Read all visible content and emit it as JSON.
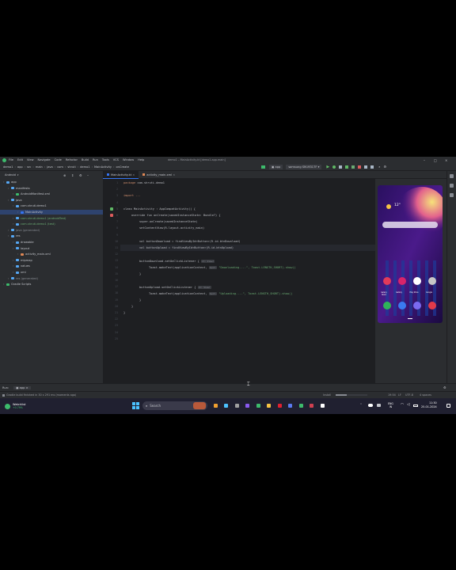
{
  "window": {
    "app_name": "demo1",
    "menus": [
      "File",
      "Edit",
      "View",
      "Navigate",
      "Code",
      "Refactor",
      "Build",
      "Run",
      "Tools",
      "VCS",
      "Window",
      "Help"
    ],
    "title": "demo1 – MainActivity.kt [demo1.app.main]"
  },
  "navbar": {
    "breadcrumbs": [
      "demo1",
      "app",
      "src",
      "main",
      "java",
      "com",
      "shruti",
      "demo1",
      "MainActivity",
      "onCreate"
    ],
    "run_config": "app",
    "device": "samsung SM-M317F"
  },
  "project_panel": {
    "title": "Android",
    "tree": [
      {
        "label": "app",
        "level": 0,
        "color": "#c4c6cc",
        "icon": "#56a8f5"
      },
      {
        "label": "manifests",
        "level": 1,
        "color": "#c4c6cc",
        "icon": "#56a8f5"
      },
      {
        "label": "AndroidManifest.xml",
        "level": 2,
        "color": "#c4c6cc",
        "icon": "#3dbb6c"
      },
      {
        "label": "java",
        "level": 1,
        "color": "#c4c6cc",
        "icon": "#56a8f5"
      },
      {
        "label": "com.shruti.demo1",
        "level": 2,
        "color": "#c4c6cc",
        "icon": "#56a8f5"
      },
      {
        "label": "MainActivity",
        "level": 3,
        "color": "#c4c6cc",
        "icon": "#3574f0"
      },
      {
        "label": "com.shruti.demo1 (androidTest)",
        "level": 2,
        "color": "#6aab73",
        "icon": "#56a8f5"
      },
      {
        "label": "com.shruti.demo1 (test)",
        "level": 2,
        "color": "#6aab73",
        "icon": "#56a8f5"
      },
      {
        "label": "java (generated)",
        "level": 1,
        "color": "#868a91",
        "icon": "#56a8f5"
      },
      {
        "label": "res",
        "level": 1,
        "color": "#c4c6cc",
        "icon": "#56a8f5"
      },
      {
        "label": "drawable",
        "level": 2,
        "color": "#c4c6cc",
        "icon": "#56a8f5"
      },
      {
        "label": "layout",
        "level": 2,
        "color": "#c4c6cc",
        "icon": "#56a8f5"
      },
      {
        "label": "activity_main.xml",
        "level": 3,
        "color": "#c4c6cc",
        "icon": "#e08855"
      },
      {
        "label": "mipmap",
        "level": 2,
        "color": "#c4c6cc",
        "icon": "#56a8f5"
      },
      {
        "label": "values",
        "level": 2,
        "color": "#c4c6cc",
        "icon": "#56a8f5"
      },
      {
        "label": "xml",
        "level": 2,
        "color": "#c4c6cc",
        "icon": "#56a8f5"
      },
      {
        "label": "res (generated)",
        "level": 1,
        "color": "#868a91",
        "icon": "#56a8f5"
      },
      {
        "label": "Gradle Scripts",
        "level": 0,
        "color": "#c4c6cc",
        "icon": "#3dbb6c"
      }
    ]
  },
  "tabs": [
    {
      "label": "MainActivity.kt",
      "active": true
    },
    {
      "label": "activity_main.xml",
      "active": false
    }
  ],
  "code": {
    "line_numbers": [
      "1",
      "2",
      "3",
      "4",
      "5",
      "6",
      "7",
      "8",
      "9",
      "10",
      "11",
      "12",
      "13",
      "14",
      "15",
      "16",
      "17",
      "18",
      "19",
      "20",
      "21",
      "22",
      "23",
      "24",
      "25"
    ],
    "package_line": "package com.shruti.demo1",
    "import_line": "import ...",
    "class_line": "class MainActivity : AppCompatActivity() {",
    "oncreate_line": "override fun onCreate(savedInstanceState: Bundle?) {",
    "super_line": "super.onCreate(savedInstanceState)",
    "setcontent_line": "setContentView(R.layout.activity_main)",
    "download_val": "val buttonDownload = findViewById<Button>(R.id.btnDownload)",
    "upload_val": "val buttonUpload = findViewById<Button>(R.id.btnUpload)",
    "download_listener": "buttonDownload.setOnClickListener {",
    "download_toast_a": "Toast.makeText(applicationContext,",
    "download_toast_b": "\"Downloading....\", Toast.LENGTH_SHORT).show()",
    "upload_listener": "buttonUpload.setOnClickListener {",
    "upload_toast_a": "Toast.makeText(applicationContext,",
    "upload_toast_b": "\"Uploading....\", Toast.LENGTH_SHORT).show()",
    "brace": "}",
    "hint_it": "it: View!",
    "hint_text": "text:"
  },
  "emulator": {
    "temperature": "12°",
    "apps": [
      "Galaxy Store",
      "Gallery",
      "Play Store",
      "Google"
    ]
  },
  "run_panel": {
    "label": "Run:",
    "config": "app"
  },
  "status": {
    "message": "Gradle build finished in 30 s 291 ms (moments ago)",
    "install": "Install",
    "position": "19:54",
    "line_sep": "LF",
    "encoding": "UTF-8",
    "indent": "4 spaces"
  },
  "taskbar": {
    "widget_title": "Watchlist",
    "widget_value": "+0.79%",
    "search_placeholder": "Search",
    "lang": "ENG",
    "lang_region": "IN",
    "time": "11:30",
    "date": "25-01-2024"
  },
  "colors": {
    "ide_bg": "#1e1f22",
    "panel_bg": "#2b2d30",
    "accent": "#3574f0",
    "keyword": "#cf8e6d",
    "string": "#6aab73",
    "function": "#56a8f5"
  }
}
